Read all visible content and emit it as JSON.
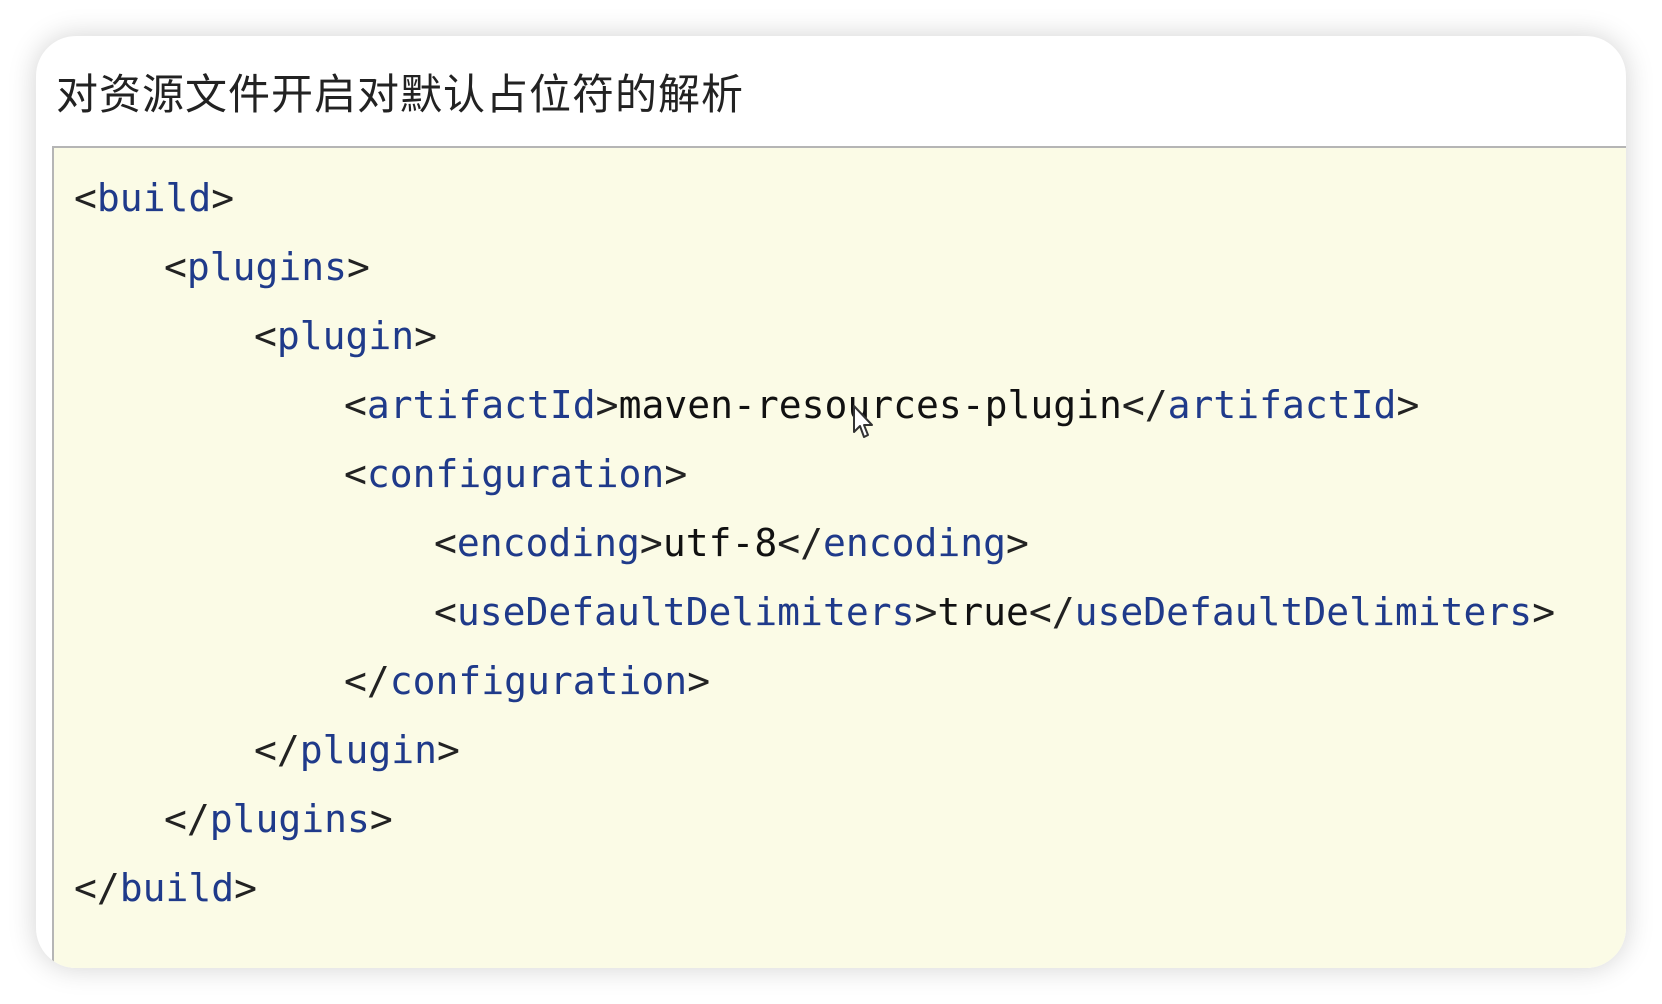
{
  "heading": "对资源文件开启对默认占位符的解析",
  "code": {
    "lines": [
      {
        "open": "<",
        "tag": "build",
        "close": ">"
      },
      {
        "open": "<",
        "tag": "plugins",
        "close": ">"
      },
      {
        "open": "<",
        "tag": "plugin",
        "close": ">"
      },
      {
        "open": "<",
        "tag": "artifactId",
        "mid": ">",
        "text": "maven-resources-plugin",
        "open2": "</",
        "tag2": "artifactId",
        "close": ">"
      },
      {
        "open": "<",
        "tag": "configuration",
        "close": ">"
      },
      {
        "open": "<",
        "tag": "encoding",
        "mid": ">",
        "text": "utf-8",
        "open2": "</",
        "tag2": "encoding",
        "close": ">"
      },
      {
        "open": "<",
        "tag": "useDefaultDelimiters",
        "mid": ">",
        "text": "true",
        "open2": "</",
        "tag2": "useDefaultDelimiters",
        "close": ">"
      },
      {
        "open": "</",
        "tag": "configuration",
        "close": ">"
      },
      {
        "open": "</",
        "tag": "plugin",
        "close": ">"
      },
      {
        "open": "</",
        "tag": "plugins",
        "close": ">"
      },
      {
        "open": "</",
        "tag": "build",
        "close": ">"
      }
    ]
  },
  "colors": {
    "tag": "#1f3a8a",
    "code_background": "#fbfbe6",
    "text": "#222222"
  },
  "icons": {
    "cursor": "mouse-pointer-icon"
  }
}
